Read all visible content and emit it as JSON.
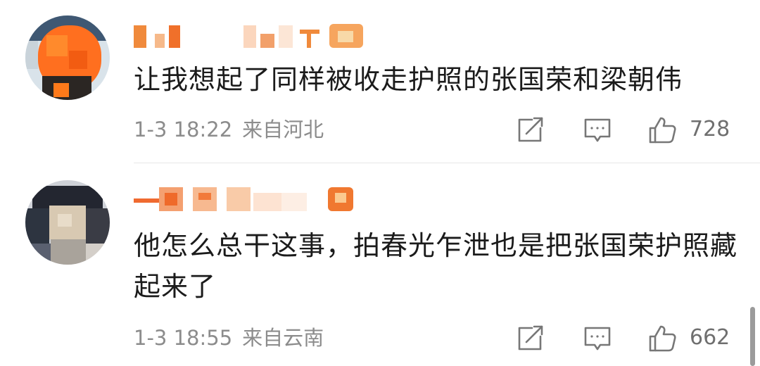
{
  "comments": [
    {
      "text": "让我想起了同样被收走护照的张国荣和梁朝伟",
      "time": "1-3 18:22",
      "location": "来自河北",
      "likes": "728"
    },
    {
      "text": "他怎么总干这事，拍春光乍泄也是把张国荣护照藏起来了",
      "time": "1-3 18:55",
      "location": "来自云南",
      "likes": "662"
    }
  ],
  "icons": {
    "share": "share-icon",
    "reply": "comment-icon",
    "like": "thumbs-up-icon"
  },
  "colors": {
    "text": "#1b1b1b",
    "meta": "#8c8c8c",
    "icon": "#777777",
    "username_censor": "#f08a3c"
  }
}
